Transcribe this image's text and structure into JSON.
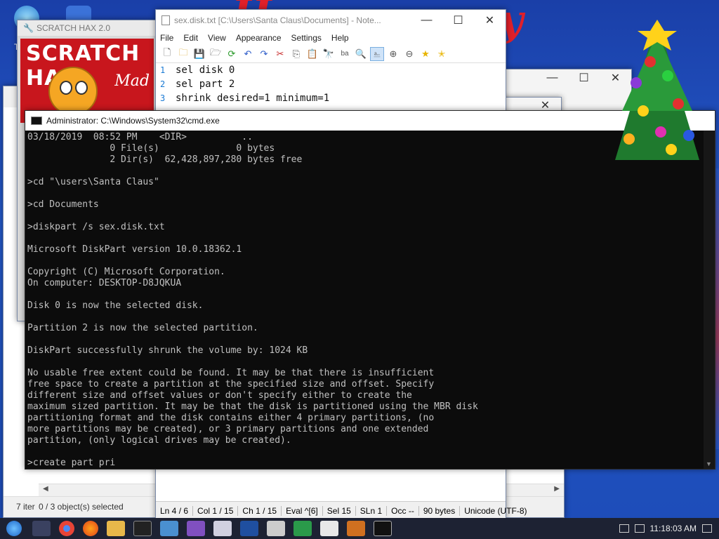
{
  "desktop": {
    "left_icon_label": "T",
    "explorer_items_count": "7 iter"
  },
  "scratch_window": {
    "title": "SCRATCH HAX 2.0",
    "banner_text": "SCRATCH HA",
    "banner_side": "Mad"
  },
  "explorer_window": {
    "status_items": "7 iter",
    "selection": "0 / 3 object(s) selected"
  },
  "notepad": {
    "title": "sex.disk.txt [C:\\Users\\Santa Claus\\Documents] - Note...",
    "menu": [
      "File",
      "Edit",
      "View",
      "Appearance",
      "Settings",
      "Help"
    ],
    "lines": [
      {
        "num": "1",
        "text": "sel disk 0"
      },
      {
        "num": "2",
        "text": "sel part 2"
      },
      {
        "num": "3",
        "text": "shrink desired=1 minimum=1"
      }
    ],
    "status": {
      "ln": "Ln 4 / 6",
      "col": "Col 1 / 15",
      "ch": "Ch 1 / 15",
      "eval": "Eval ^[6]",
      "sel": "Sel 15",
      "sln": "SLn 1",
      "occ": "Occ --",
      "size": "90 bytes",
      "encoding": "Unicode (UTF-8)"
    }
  },
  "cmd": {
    "title": "Administrator: C:\\Windows\\System32\\cmd.exe",
    "lines": [
      "03/18/2019  08:52 PM    <DIR>          ..",
      "               0 File(s)              0 bytes",
      "               2 Dir(s)  62,428,897,280 bytes free",
      "",
      ">cd \"\\users\\Santa Claus\"",
      "",
      ">cd Documents",
      "",
      ">diskpart /s sex.disk.txt",
      "",
      "Microsoft DiskPart version 10.0.18362.1",
      "",
      "Copyright (C) Microsoft Corporation.",
      "On computer: DESKTOP-D8JQKUA",
      "",
      "Disk 0 is now the selected disk.",
      "",
      "Partition 2 is now the selected partition.",
      "",
      "DiskPart successfully shrunk the volume by: 1024 KB",
      "",
      "No usable free extent could be found. It may be that there is insufficient",
      "free space to create a partition at the specified size and offset. Specify",
      "different size and offset values or don't specify either to create the",
      "maximum sized partition. It may be that the disk is partitioned using the MBR disk",
      "partitioning format and the disk contains either 4 primary partitions, (no",
      "more partitions may be created), or 3 primary partitions and one extended",
      "partition, (only logical drives may be created).",
      "",
      ">create part pri"
    ]
  },
  "taskbar": {
    "clock": "11:18:03 AM"
  },
  "colors": {
    "cmd_bg": "#0c0c0c",
    "cmd_text": "#c0c0c0",
    "line_number": "#1a7ad4",
    "desktop_red": "#e0202a"
  }
}
